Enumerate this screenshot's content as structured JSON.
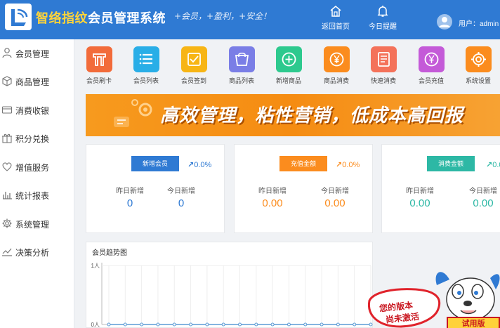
{
  "header": {
    "title_brand": "智络指纹",
    "title_rest": "会员管理系统",
    "slogan": "+会员，+盈利，+安全！",
    "nav": [
      {
        "label": "返回首页",
        "icon": "home-icon"
      },
      {
        "label": "今日提醒",
        "icon": "bell-icon"
      }
    ],
    "user_label": "用户：admin"
  },
  "sidebar": {
    "items": [
      {
        "label": "会员管理",
        "icon": "user-icon"
      },
      {
        "label": "商品管理",
        "icon": "box-icon"
      },
      {
        "label": "消费收银",
        "icon": "cashier-icon"
      },
      {
        "label": "积分兑换",
        "icon": "gift-icon"
      },
      {
        "label": "增值服务",
        "icon": "heart-icon"
      },
      {
        "label": "统计报表",
        "icon": "bar-chart-icon"
      },
      {
        "label": "系统管理",
        "icon": "gear-icon"
      },
      {
        "label": "决策分析",
        "icon": "trend-icon"
      }
    ]
  },
  "quick_actions": [
    {
      "label": "会员刷卡",
      "icon": "card-swipe-icon",
      "color": "#f26b3a"
    },
    {
      "label": "会员列表",
      "icon": "list-icon",
      "color": "#29aee7"
    },
    {
      "label": "会员签到",
      "icon": "checkin-icon",
      "color": "#f7b515"
    },
    {
      "label": "商品列表",
      "icon": "bag-icon",
      "color": "#7a7ee6"
    },
    {
      "label": "新增商品",
      "icon": "plus-circle-icon",
      "color": "#2dc98e"
    },
    {
      "label": "商品消费",
      "icon": "yen-coin-icon",
      "color": "#fb8c1e"
    },
    {
      "label": "快速消费",
      "icon": "quick-doc-icon",
      "color": "#f4725a"
    },
    {
      "label": "会员充值",
      "icon": "recharge-icon",
      "color": "#c45ad8"
    },
    {
      "label": "系统设置",
      "icon": "gear-icon",
      "color": "#fb8c1e"
    }
  ],
  "banner": {
    "text": "高效管理，粘性营销，低成本高回报"
  },
  "cards": [
    {
      "tag": "新增会员",
      "tag_color": "#2f7ad3",
      "pct": "0.0%",
      "pct_color": "#2f7ad3",
      "yesterday_label": "昨日新增",
      "today_label": "今日新增",
      "yesterday_value": "0",
      "today_value": "0",
      "value_color": "#2f7ad3"
    },
    {
      "tag": "充值金额",
      "tag_color": "#fb8c1e",
      "pct": "0.0%",
      "pct_color": "#fb8c1e",
      "yesterday_label": "昨日新增",
      "today_label": "今日新增",
      "yesterday_value": "0.00",
      "today_value": "0.00",
      "value_color": "#fb8c1e"
    },
    {
      "tag": "消费金额",
      "tag_color": "#2db8a5",
      "pct": "0.0%",
      "pct_color": "#2db8a5",
      "yesterday_label": "昨日新增",
      "today_label": "今日新增",
      "yesterday_value": "0.00",
      "today_value": "0.00",
      "value_color": "#2db8a5"
    }
  ],
  "chart_panel_title": "会员趋势图",
  "chart_data": {
    "type": "line",
    "title": "会员趋势图",
    "y_tick_labels": [
      "1人",
      "0人"
    ],
    "ylim": [
      0,
      1
    ],
    "grid": true,
    "series": [
      {
        "values": [
          0,
          0,
          0,
          0,
          0,
          0,
          0,
          0,
          0,
          0,
          0,
          0,
          0,
          0,
          0,
          0,
          0
        ],
        "color": "#5b9bd5"
      }
    ]
  },
  "trial": {
    "line1": "您的版本",
    "line2": "尚未激活",
    "button": "试用版"
  }
}
